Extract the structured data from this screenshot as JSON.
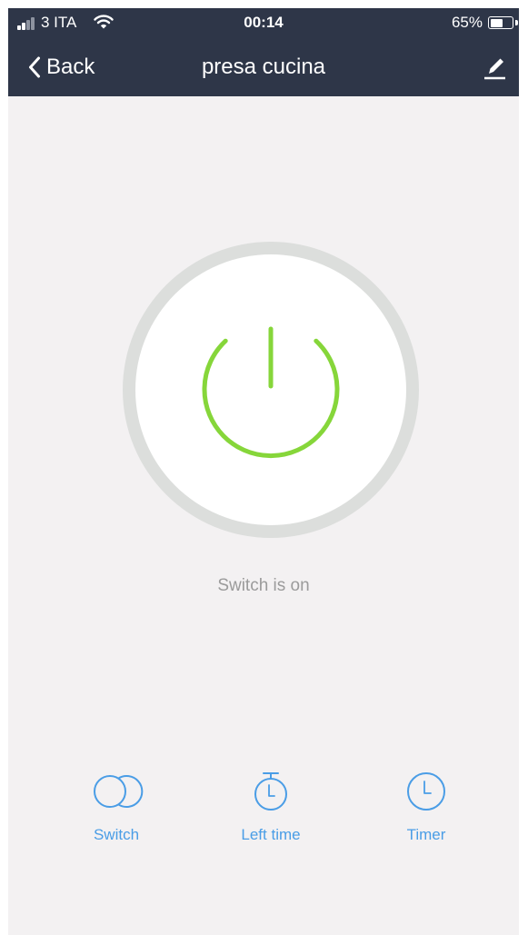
{
  "status_bar": {
    "carrier": "3 ITA",
    "time": "00:14",
    "battery_percent_label": "65%",
    "battery_level": 0.65
  },
  "nav": {
    "back_label": "Back",
    "title": "presa cucina"
  },
  "device": {
    "status_text": "Switch is on"
  },
  "actions": [
    {
      "label": "Switch",
      "icon": "switch-icon"
    },
    {
      "label": "Left time",
      "icon": "stopwatch-icon"
    },
    {
      "label": "Timer",
      "icon": "clock-icon"
    }
  ],
  "colors": {
    "header_bg": "#2e3648",
    "page_bg": "#f3f1f2",
    "power_on": "#86d63a",
    "accent_blue": "#4a9de6",
    "status_text": "#9b9b9b"
  }
}
